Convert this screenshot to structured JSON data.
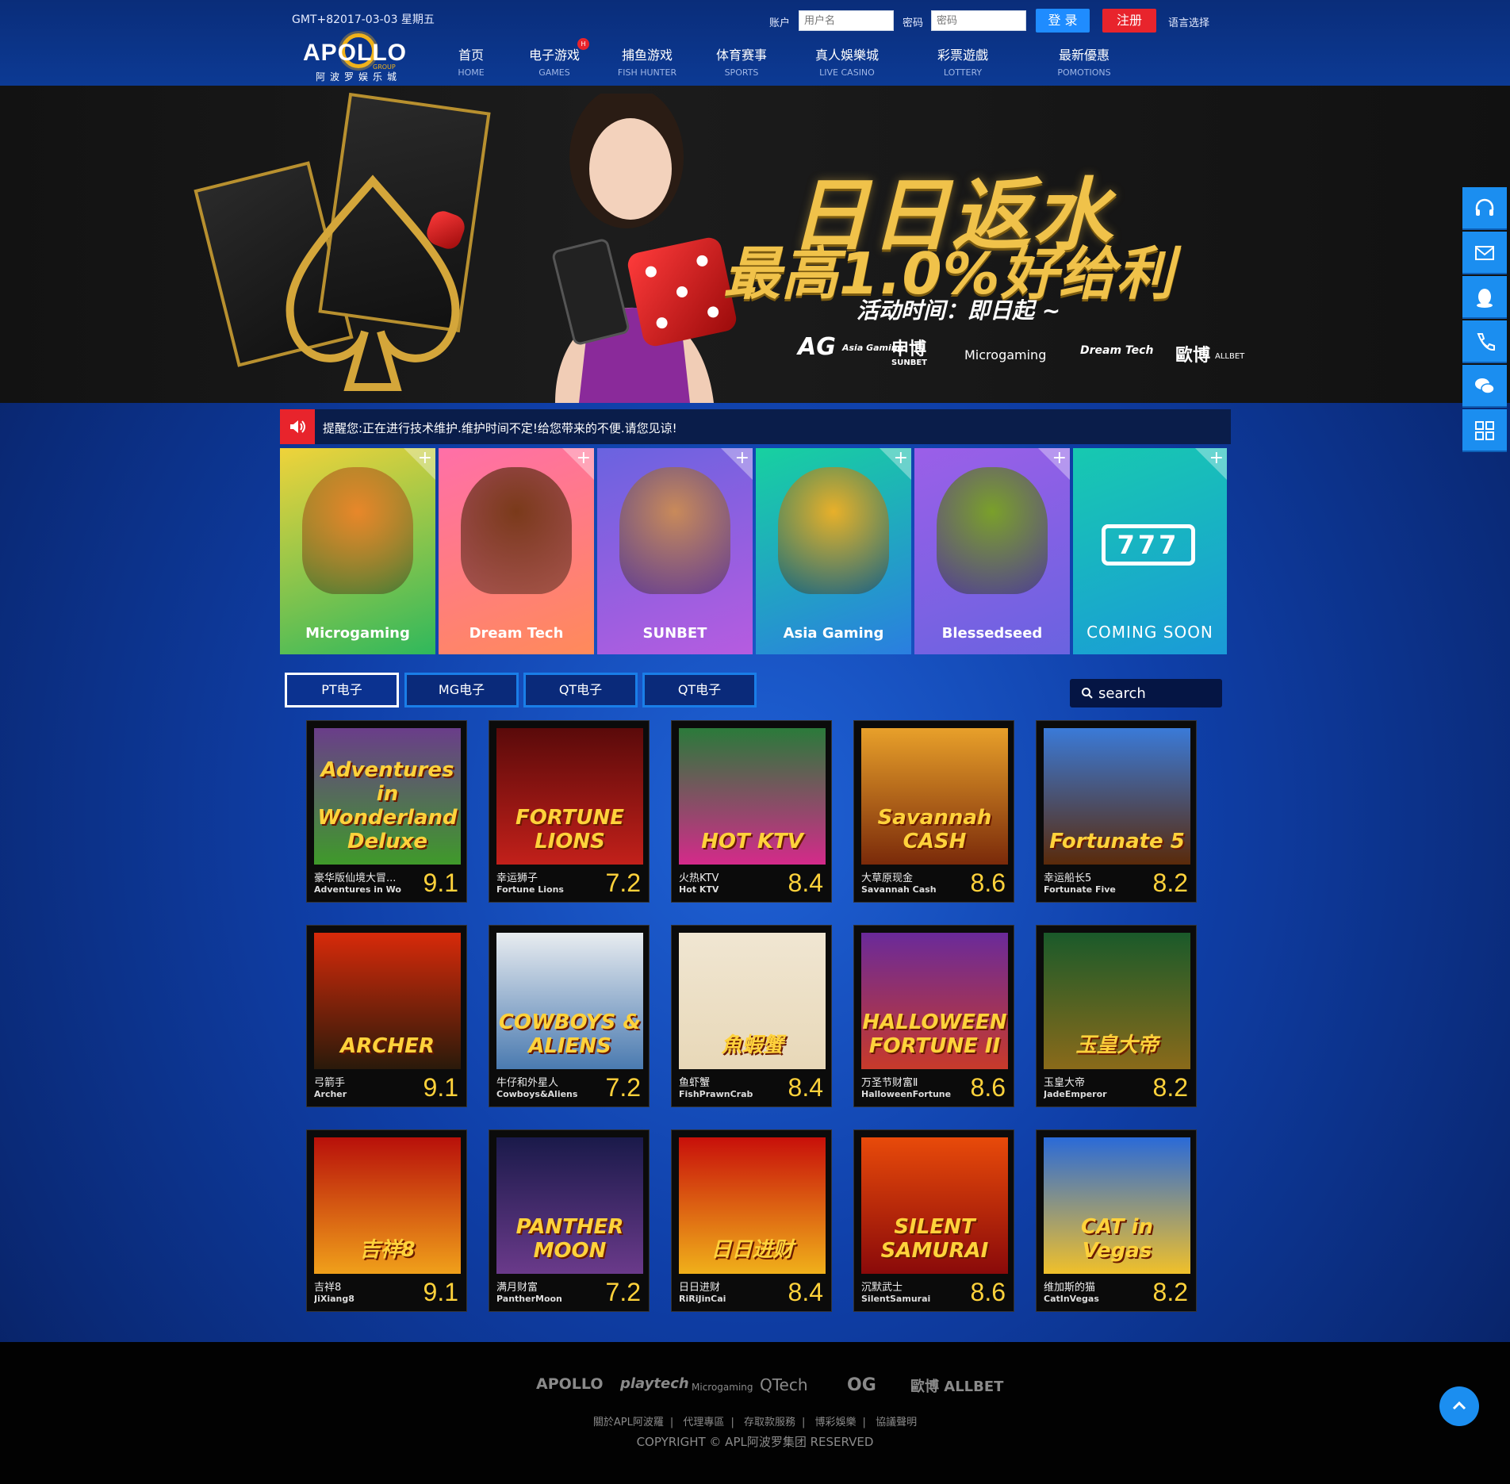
{
  "header": {
    "datetime": "GMT+82017-03-03 星期五",
    "account_label": "账户",
    "account_placeholder": "用户名",
    "password_label": "密码",
    "password_placeholder": "密码",
    "login_label": "登 录",
    "register_label": "注册",
    "language_label": "语言选择",
    "logo_text": "APOLLO",
    "logo_group": "GROUP",
    "logo_sub": "阿波罗娱乐城",
    "nav": [
      {
        "cn": "首页",
        "en": "HOME"
      },
      {
        "cn": "电子游戏",
        "en": "GAMES",
        "badge": "H"
      },
      {
        "cn": "捕鱼游戏",
        "en": "FISH HUNTER"
      },
      {
        "cn": "体育赛事",
        "en": "SPORTS"
      },
      {
        "cn": "真人娛樂城",
        "en": "LIVE CASINO"
      },
      {
        "cn": "彩票遊戲",
        "en": "LOTTERY"
      },
      {
        "cn": "最新優惠",
        "en": "POMOTIONS"
      }
    ]
  },
  "banner": {
    "line1": "日日返水",
    "line2": "最高1.0%好给利",
    "line3": "活动时间：即日起 ~",
    "partners": [
      "AG",
      "Asia Gaming",
      "申博",
      "SUNBET",
      "Microgaming",
      "Dream Tech",
      "歐博",
      "ALLBET"
    ]
  },
  "notice": {
    "text": "提醒您:正在进行技术维护.维护时间不定!给您带来的不便.请您见谅!"
  },
  "providers": [
    {
      "label": "Microgaming",
      "color1": "#f0d33a",
      "color2": "#2fb85c"
    },
    {
      "label": "Dream Tech",
      "color1": "#ff6fa8",
      "color2": "#ff8a5a"
    },
    {
      "label": "SUNBET",
      "color1": "#6a63e0",
      "color2": "#b65ce0"
    },
    {
      "label": "Asia Gaming",
      "color1": "#17d1a0",
      "color2": "#2a7ee0"
    },
    {
      "label": "Blessedseed",
      "color1": "#9b5fe8",
      "color2": "#6a63e0"
    },
    {
      "label": "COMING SOON",
      "color1": "#17c9b0",
      "color2": "#1a9ad8",
      "symbol": "777"
    }
  ],
  "tabs": [
    "PT电子",
    "MG电子",
    "QT电子",
    "QT电子"
  ],
  "search": {
    "placeholder": "search"
  },
  "games": [
    {
      "cn": "豪华版仙境大冒...",
      "en": "Adventures in Wo",
      "score": "9.1",
      "art": "Adventures in Wonderland Deluxe",
      "bg1": "#6a3d8a",
      "bg2": "#3f9a2a"
    },
    {
      "cn": "幸运狮子",
      "en": "Fortune Lions",
      "score": "7.2",
      "art": "FORTUNE LIONS",
      "bg1": "#5a0a0a",
      "bg2": "#c2201a"
    },
    {
      "cn": "火热KTV",
      "en": "Hot KTV",
      "score": "8.4",
      "art": "HOT KTV",
      "bg1": "#2a7a3a",
      "bg2": "#d42a8a"
    },
    {
      "cn": "大草原现金",
      "en": "Savannah Cash",
      "score": "8.6",
      "art": "Savannah CASH",
      "bg1": "#e8a02a",
      "bg2": "#7a2a0a"
    },
    {
      "cn": "幸运船长5",
      "en": "Fortunate Five",
      "score": "8.2",
      "art": "Fortunate 5",
      "bg1": "#3a7ad8",
      "bg2": "#5a2a0a"
    },
    {
      "cn": "弓箭手",
      "en": "Archer",
      "score": "9.1",
      "art": "ARCHER",
      "bg1": "#d82a0a",
      "bg2": "#2a1a0a"
    },
    {
      "cn": "牛仔和外星人",
      "en": "Cowboys&Aliens",
      "score": "7.2",
      "art": "COWBOYS & ALIENS",
      "bg1": "#e8ecf0",
      "bg2": "#4a7ab0"
    },
    {
      "cn": "鱼虾蟹",
      "en": "FishPrawnCrab",
      "score": "8.4",
      "art": "魚蝦蟹",
      "bg1": "#f0e6d2",
      "bg2": "#e8d8b8"
    },
    {
      "cn": "万圣节财富Ⅱ",
      "en": "HalloweenFortune",
      "score": "8.6",
      "art": "HALLOWEEN FORTUNE II",
      "bg1": "#6a2a9a",
      "bg2": "#c83a2a"
    },
    {
      "cn": "玉皇大帝",
      "en": "JadeEmperor",
      "score": "8.2",
      "art": "玉皇大帝",
      "bg1": "#1a5a2a",
      "bg2": "#8a6a1a"
    },
    {
      "cn": "吉祥8",
      "en": "JiXiang8",
      "score": "9.1",
      "art": "吉祥8",
      "bg1": "#b8100a",
      "bg2": "#f0a01a"
    },
    {
      "cn": "满月财富",
      "en": "PantherMoon",
      "score": "7.2",
      "art": "PANTHER MOON",
      "bg1": "#1a1a4a",
      "bg2": "#6a3a8a"
    },
    {
      "cn": "日日进财",
      "en": "RiRiJinCai",
      "score": "8.4",
      "art": "日日进财",
      "bg1": "#c8100a",
      "bg2": "#f0b01a"
    },
    {
      "cn": "沉默武士",
      "en": "SilentSamurai",
      "score": "8.6",
      "art": "SILENT SAMURAI",
      "bg1": "#e84a0a",
      "bg2": "#8a0a0a"
    },
    {
      "cn": "维加斯的猫",
      "en": "CatInVegas",
      "score": "8.2",
      "art": "CAT in Vegas",
      "bg1": "#2a6ad8",
      "bg2": "#f0c02a"
    }
  ],
  "footer": {
    "logos": [
      "APOLLO",
      "playtech",
      "Microgaming",
      "QTech",
      "OG",
      "歐博 ALLBET"
    ],
    "links": [
      "關於APL阿波羅",
      "代理專區",
      "存取款服務",
      "博彩娛樂",
      "協議聲明"
    ],
    "copyright": "COPYRIGHT © APL阿波罗集团 RESERVED"
  },
  "sidebar": [
    "headset-icon",
    "mail-icon",
    "qq-icon",
    "phone-icon",
    "wechat-icon",
    "qr-icon"
  ],
  "colors": {
    "accent_blue": "#1b8ef0",
    "accent_red": "#e8242c",
    "gold": "#ffd23b"
  }
}
